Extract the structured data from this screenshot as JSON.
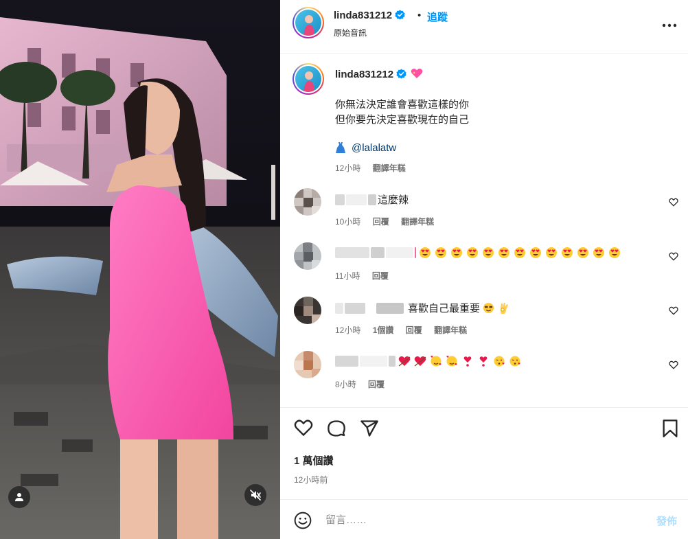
{
  "post": {
    "username": "linda831212",
    "follow_label": "追蹤",
    "separator": "•",
    "audio_label": "原始音訊",
    "caption": {
      "username": "linda831212",
      "line1": "你無法決定誰會喜歡這樣的你",
      "line2": "但你要先決定喜歡現在的自己",
      "mention": "@lalalatw",
      "time": "12小時",
      "translate_label": "翻譯年糕"
    },
    "comments": [
      {
        "text": "這麼辣",
        "time": "10小時",
        "reply_label": "回覆",
        "translate_label": "翻譯年糕"
      },
      {
        "text": "",
        "time": "11小時",
        "reply_label": "回覆"
      },
      {
        "text": "喜歡自己最重要",
        "time": "12小時",
        "likes_label": "1個讚",
        "reply_label": "回覆",
        "translate_label": "翻譯年糕"
      },
      {
        "text": "",
        "time": "8小時",
        "reply_label": "回覆"
      }
    ],
    "likes_count": "1 萬個讚",
    "posted_ago": "12小時前",
    "composer": {
      "placeholder": "留言……",
      "post_label": "發佈"
    }
  },
  "colors": {
    "link_blue": "#0095f6",
    "mention_blue": "#00376b",
    "muted_text": "#737373",
    "post_button_disabled": "#b2dffc"
  },
  "icons": [
    "verified-badge-icon",
    "more-options-icon",
    "dress-icon",
    "heart-outline-icon",
    "comment-icon",
    "share-icon",
    "bookmark-icon",
    "emoji-smile-icon",
    "user-tag-icon",
    "muted-audio-icon"
  ]
}
